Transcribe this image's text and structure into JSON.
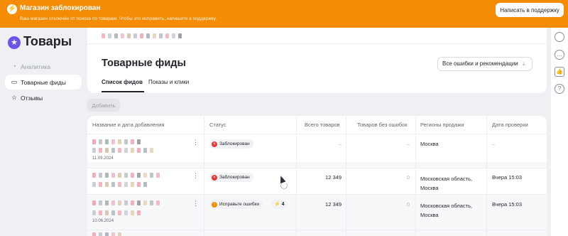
{
  "banner": {
    "icon": "lightning-icon",
    "title": "Магазин заблокирован",
    "subtitle": "Ваш магазин отключён от поиска по товарам. Чтобы это исправить, напишите в поддержку.",
    "support_button": "Написать в поддержку",
    "color": "#f48c06"
  },
  "sidebar": {
    "logo_icon": "star-icon",
    "title": "Товары",
    "items": [
      {
        "label": "Аналитика",
        "icon": "analytics-icon",
        "state": "disabled"
      },
      {
        "label": "Товарные фиды",
        "icon": "feed-icon",
        "state": "active"
      },
      {
        "label": "Отзывы",
        "icon": "star-outline-icon",
        "state": "normal"
      }
    ]
  },
  "header": {
    "title": "Товарные фиды",
    "errors_button": "Все ошибки и рекомендации",
    "tabs": [
      {
        "label": "Список фидов",
        "active": true
      },
      {
        "label": "Показы и клики",
        "active": false
      }
    ]
  },
  "toolbar": {
    "add_button": "Добавить"
  },
  "table": {
    "columns": [
      "Название и дата добавления",
      "Статус",
      "Всего товаров",
      "Товаров без ошибок",
      "Регионы продажи",
      "Дата проверки"
    ],
    "rows": [
      {
        "date": "11.09.2024",
        "status": "Заблокирован",
        "status_kind": "blocked",
        "total": "–",
        "no_errors": "–",
        "region": "Москва",
        "checked": "–"
      },
      {
        "date": "",
        "status": "Заблокирован",
        "status_kind": "blocked",
        "total": "12 349",
        "no_errors": "0",
        "region": "Московская область, Москва",
        "checked": "Вчера 15:03"
      },
      {
        "date": "10.06.2024",
        "status": "Исправьте ошибки",
        "status_kind": "errors",
        "error_count": "4",
        "total": "12 349",
        "no_errors": "0",
        "region": "Московская область, Москва",
        "checked": "Вчера 15:03"
      }
    ]
  },
  "rail_icons": [
    "avatar-icon",
    "chat-icon",
    "thumbs-up-icon",
    "help-icon"
  ]
}
